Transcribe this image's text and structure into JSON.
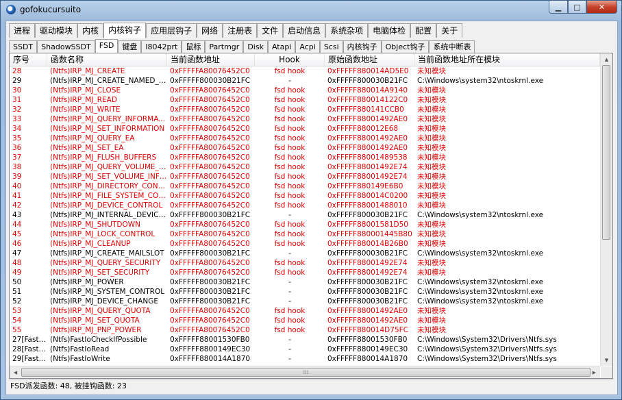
{
  "window": {
    "title": "gofokucursuito"
  },
  "tabs_main": [
    "进程",
    "驱动模块",
    "内核",
    "内核钩子",
    "应用层钩子",
    "网络",
    "注册表",
    "文件",
    "启动信息",
    "系统杂项",
    "电脑体检",
    "配置",
    "关于"
  ],
  "tabs_main_active": 3,
  "tabs_sub": [
    "SSDT",
    "ShadowSSDT",
    "FSD",
    "键盘",
    "I8042prt",
    "鼠标",
    "Partmgr",
    "Disk",
    "Atapi",
    "Acpi",
    "Scsi",
    "内核钩子",
    "Object钩子",
    "系统中断表"
  ],
  "tabs_sub_active": 2,
  "columns": [
    "序号",
    "函数名称",
    "当前函数地址",
    "Hook",
    "原始函数地址",
    "当前函数地址所在模块"
  ],
  "rows": [
    {
      "id": "28",
      "name": "(Ntfs)IRP_MJ_CREATE",
      "cur": "0xFFFFFA80076452C0",
      "hook": "fsd hook",
      "orig": "0xFFFFF880014AD5E0",
      "module": "未知模块",
      "hooked": true
    },
    {
      "id": "29",
      "name": "(Ntfs)IRP_MJ_CREATE_NAMED_PIPE",
      "cur": "0xFFFFF800030B21FC",
      "hook": "-",
      "orig": "0xFFFFF800030B21FC",
      "module": "C:\\Windows\\system32\\ntoskrnl.exe",
      "hooked": false
    },
    {
      "id": "30",
      "name": "(Ntfs)IRP_MJ_CLOSE",
      "cur": "0xFFFFFA80076452C0",
      "hook": "fsd hook",
      "orig": "0xFFFFF880014A9140",
      "module": "未知模块",
      "hooked": true
    },
    {
      "id": "31",
      "name": "(Ntfs)IRP_MJ_READ",
      "cur": "0xFFFFFA80076452C0",
      "hook": "fsd hook",
      "orig": "0xFFFFF880014122C0",
      "module": "未知模块",
      "hooked": true
    },
    {
      "id": "32",
      "name": "(Ntfs)IRP_MJ_WRITE",
      "cur": "0xFFFFFA80076452C0",
      "hook": "fsd hook",
      "orig": "0xFFFFF880141CCB0",
      "module": "未知模块",
      "hooked": true
    },
    {
      "id": "33",
      "name": "(Ntfs)IRP_MJ_QUERY_INFORMATION",
      "cur": "0xFFFFFA80076452C0",
      "hook": "fsd hook",
      "orig": "0xFFFFF88001492AE0",
      "module": "未知模块",
      "hooked": true
    },
    {
      "id": "34",
      "name": "(Ntfs)IRP_MJ_SET_INFORMATION",
      "cur": "0xFFFFFA80076452C0",
      "hook": "fsd hook",
      "orig": "0xFFFFF880012E68",
      "module": "未知模块",
      "hooked": true
    },
    {
      "id": "35",
      "name": "(Ntfs)IRP_MJ_QUERY_EA",
      "cur": "0xFFFFFA80076452C0",
      "hook": "fsd hook",
      "orig": "0xFFFFF88001492AE0",
      "module": "未知模块",
      "hooked": true
    },
    {
      "id": "36",
      "name": "(Ntfs)IRP_MJ_SET_EA",
      "cur": "0xFFFFFA80076452C0",
      "hook": "fsd hook",
      "orig": "0xFFFFF88001492AE0",
      "module": "未知模块",
      "hooked": true
    },
    {
      "id": "37",
      "name": "(Ntfs)IRP_MJ_FLUSH_BUFFERS",
      "cur": "0xFFFFFA80076452C0",
      "hook": "fsd hook",
      "orig": "0xFFFFF88001489538",
      "module": "未知模块",
      "hooked": true
    },
    {
      "id": "38",
      "name": "(Ntfs)IRP_MJ_QUERY_VOLUME_INFORMATION",
      "cur": "0xFFFFFA80076452C0",
      "hook": "fsd hook",
      "orig": "0xFFFFF88001492E74",
      "module": "未知模块",
      "hooked": true
    },
    {
      "id": "39",
      "name": "(Ntfs)IRP_MJ_SET_VOLUME_INFORMATION",
      "cur": "0xFFFFFA80076452C0",
      "hook": "fsd hook",
      "orig": "0xFFFFF88001492E74",
      "module": "未知模块",
      "hooked": true
    },
    {
      "id": "40",
      "name": "(Ntfs)IRP_MJ_DIRECTORY_CONTROL",
      "cur": "0xFFFFFA80076452C0",
      "hook": "fsd hook",
      "orig": "0xFFFFF880149E6B0",
      "module": "未知模块",
      "hooked": true
    },
    {
      "id": "41",
      "name": "(Ntfs)IRP_MJ_FILE_SYSTEM_CONTROL",
      "cur": "0xFFFFFA80076452C0",
      "hook": "fsd hook",
      "orig": "0xFFFFF880014C0200",
      "module": "未知模块",
      "hooked": true
    },
    {
      "id": "42",
      "name": "(Ntfs)IRP_MJ_DEVICE_CONTROL",
      "cur": "0xFFFFFA80076452C0",
      "hook": "fsd hook",
      "orig": "0xFFFFF88001488010",
      "module": "未知模块",
      "hooked": true
    },
    {
      "id": "43",
      "name": "(Ntfs)IRP_MJ_INTERNAL_DEVICE_CONTROL",
      "cur": "0xFFFFF800030B21FC",
      "hook": "-",
      "orig": "0xFFFFF800030B21FC",
      "module": "C:\\Windows\\system32\\ntoskrnl.exe",
      "hooked": false
    },
    {
      "id": "44",
      "name": "(Ntfs)IRP_MJ_SHUTDOWN",
      "cur": "0xFFFFFA80076452C0",
      "hook": "fsd hook",
      "orig": "0xFFFFF88001581D50",
      "module": "未知模块",
      "hooked": true
    },
    {
      "id": "45",
      "name": "(Ntfs)IRP_MJ_LOCK_CONTROL",
      "cur": "0xFFFFFA80076452C0",
      "hook": "fsd hook",
      "orig": "0xFFFFF880001445B80",
      "module": "未知模块",
      "hooked": true
    },
    {
      "id": "46",
      "name": "(Ntfs)IRP_MJ_CLEANUP",
      "cur": "0xFFFFFA80076452C0",
      "hook": "fsd hook",
      "orig": "0xFFFFF880014B26B0",
      "module": "未知模块",
      "hooked": true
    },
    {
      "id": "47",
      "name": "(Ntfs)IRP_MJ_CREATE_MAILSLOT",
      "cur": "0xFFFFF800030B21FC",
      "hook": "-",
      "orig": "0xFFFFF800030B21FC",
      "module": "C:\\Windows\\system32\\ntoskrnl.exe",
      "hooked": false
    },
    {
      "id": "48",
      "name": "(Ntfs)IRP_MJ_QUERY_SECURITY",
      "cur": "0xFFFFFA80076452C0",
      "hook": "fsd hook",
      "orig": "0xFFFFF88001492E74",
      "module": "未知模块",
      "hooked": true
    },
    {
      "id": "49",
      "name": "(Ntfs)IRP_MJ_SET_SECURITY",
      "cur": "0xFFFFFA80076452C0",
      "hook": "fsd hook",
      "orig": "0xFFFFF88001492E74",
      "module": "未知模块",
      "hooked": true
    },
    {
      "id": "50",
      "name": "(Ntfs)IRP_MJ_POWER",
      "cur": "0xFFFFF800030B21FC",
      "hook": "-",
      "orig": "0xFFFFF800030B21FC",
      "module": "C:\\Windows\\system32\\ntoskrnl.exe",
      "hooked": false
    },
    {
      "id": "51",
      "name": "(Ntfs)IRP_MJ_SYSTEM_CONTROL",
      "cur": "0xFFFFF800030B21FC",
      "hook": "-",
      "orig": "0xFFFFF800030B21FC",
      "module": "C:\\Windows\\system32\\ntoskrnl.exe",
      "hooked": false
    },
    {
      "id": "52",
      "name": "(Ntfs)IRP_MJ_DEVICE_CHANGE",
      "cur": "0xFFFFF800030B21FC",
      "hook": "-",
      "orig": "0xFFFFF800030B21FC",
      "module": "C:\\Windows\\system32\\ntoskrnl.exe",
      "hooked": false
    },
    {
      "id": "53",
      "name": "(Ntfs)IRP_MJ_QUERY_QUOTA",
      "cur": "0xFFFFFA80076452C0",
      "hook": "fsd hook",
      "orig": "0xFFFFF88001492AE0",
      "module": "未知模块",
      "hooked": true
    },
    {
      "id": "54",
      "name": "(Ntfs)IRP_MJ_SET_QUOTA",
      "cur": "0xFFFFFA80076452C0",
      "hook": "fsd hook",
      "orig": "0xFFFFF88001492AE0",
      "module": "未知模块",
      "hooked": true
    },
    {
      "id": "55",
      "name": "(Ntfs)IRP_MJ_PNP_POWER",
      "cur": "0xFFFFFA80076452C0",
      "hook": "fsd hook",
      "orig": "0xFFFFF880014D75FC",
      "module": "未知模块",
      "hooked": true
    },
    {
      "id": "27[Fast...",
      "name": "(Ntfs)FastIoCheckIfPossible",
      "cur": "0xFFFFF88001530FB0",
      "hook": "-",
      "orig": "0xFFFFF88001530FB0",
      "module": "C:\\Windows\\System32\\Drivers\\Ntfs.sys",
      "hooked": false
    },
    {
      "id": "28[Fast...",
      "name": "(Ntfs)FastIoRead",
      "cur": "0xFFFFF8800149EC30",
      "hook": "-",
      "orig": "0xFFFFF8800149EC30",
      "module": "C:\\Windows\\System32\\Drivers\\Ntfs.sys",
      "hooked": false
    },
    {
      "id": "29[Fast...",
      "name": "(Ntfs)FastIoWrite",
      "cur": "0xFFFFF880014A1870",
      "hook": "-",
      "orig": "0xFFFFF880014A1870",
      "module": "C:\\Windows\\System32\\Drivers\\Ntfs.sys",
      "hooked": false
    }
  ],
  "status": "FSD派发函数: 48, 被挂钩函数: 23",
  "colors": {
    "hooked": "#e00000",
    "normal": "#000000"
  }
}
